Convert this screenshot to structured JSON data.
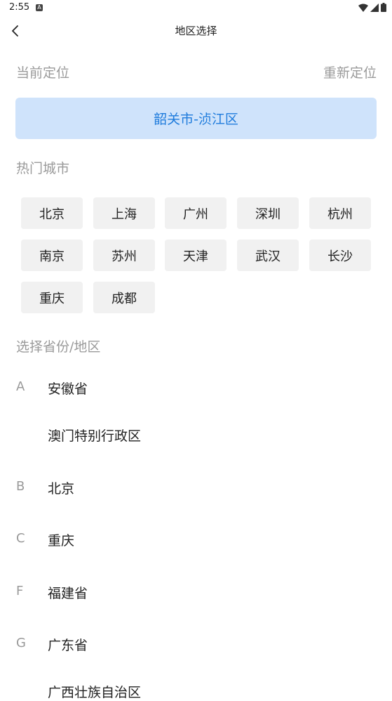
{
  "status": {
    "time": "2:55",
    "app_icon": "A"
  },
  "header": {
    "title": "地区选择"
  },
  "current": {
    "label": "当前定位",
    "relocate": "重新定位",
    "location": "韶关市-浈江区"
  },
  "hot": {
    "label": "热门城市",
    "cities": [
      "北京",
      "上海",
      "广州",
      "深圳",
      "杭州",
      "南京",
      "苏州",
      "天津",
      "武汉",
      "长沙",
      "重庆",
      "成都"
    ]
  },
  "provinces": {
    "label": "选择省份/地区",
    "groups": [
      {
        "letter": "A",
        "items": [
          "安徽省",
          "澳门特别行政区"
        ]
      },
      {
        "letter": "B",
        "items": [
          "北京"
        ]
      },
      {
        "letter": "C",
        "items": [
          "重庆"
        ]
      },
      {
        "letter": "F",
        "items": [
          "福建省"
        ]
      },
      {
        "letter": "G",
        "items": [
          "广东省",
          "广西壮族自治区"
        ]
      }
    ]
  },
  "colors": {
    "accent": "#1e7bdc",
    "accent_bg": "#cfe3fb",
    "muted": "#9a9a9a",
    "chip_bg": "#f1f1f1"
  }
}
